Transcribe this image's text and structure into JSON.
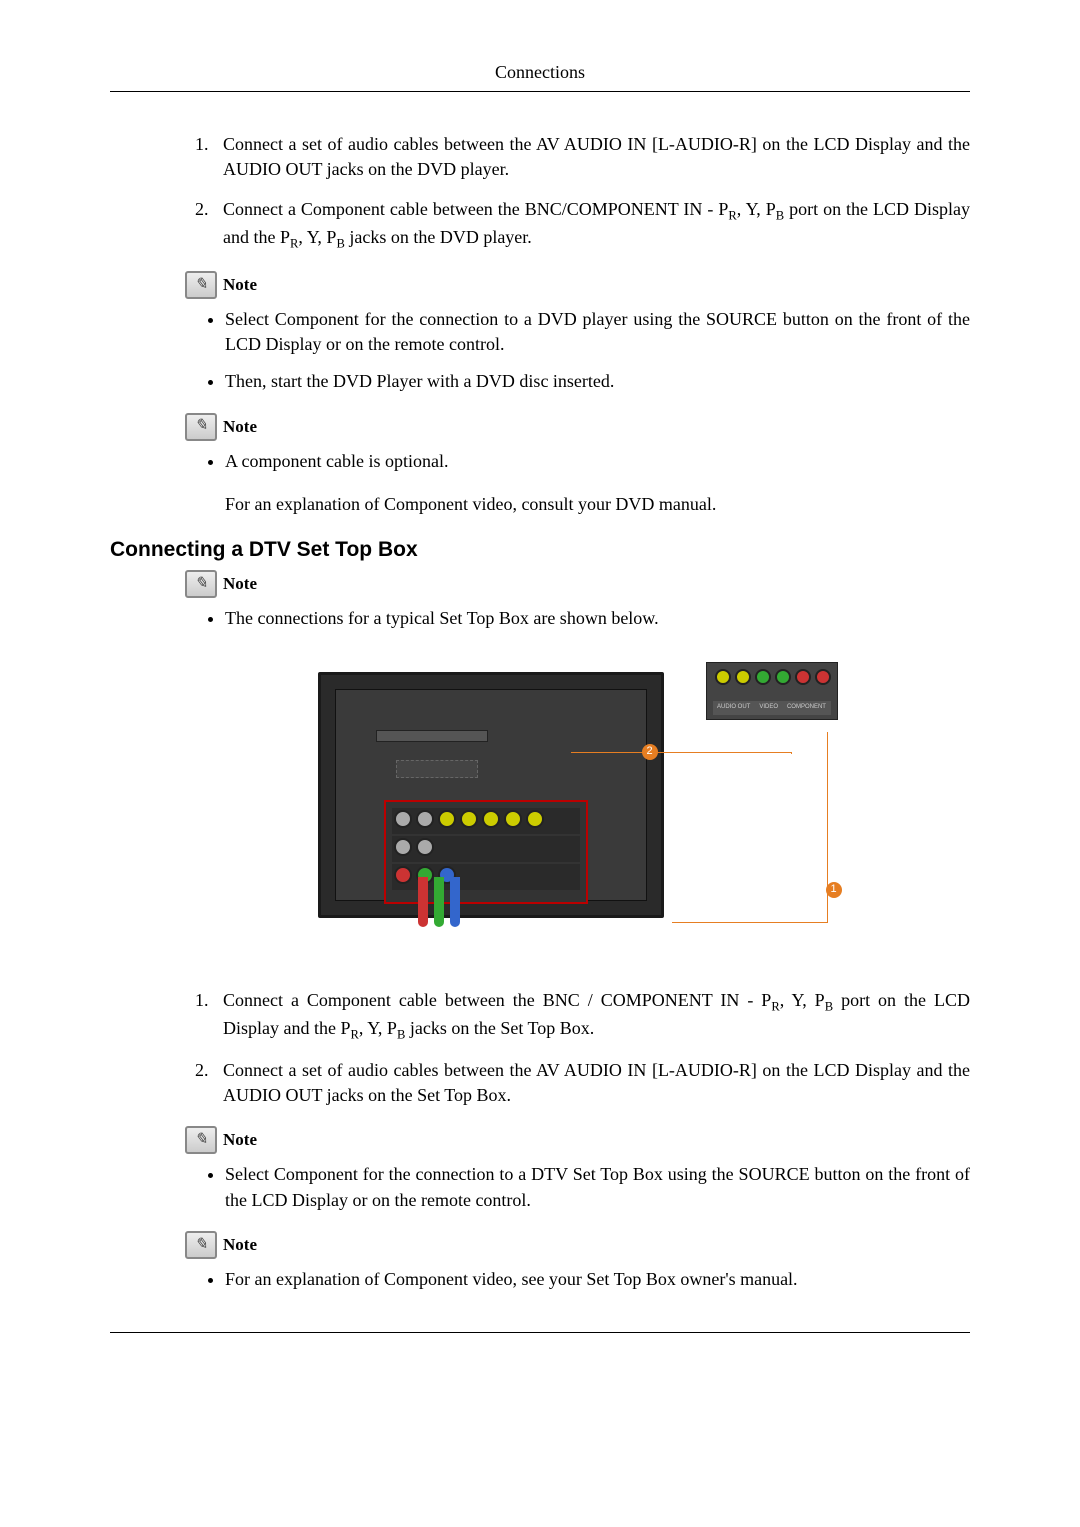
{
  "header": {
    "title": "Connections"
  },
  "steps_top": {
    "1": "Connect a set of audio cables between the AV AUDIO IN [L-AUDIO-R] on the LCD Display and the AUDIO OUT jacks on the DVD player.",
    "2_pre": "Connect a Component cable between the BNC/COMPONENT IN - P",
    "2_mid1": ", Y, P",
    "2_mid2": " port on the LCD Display and the P",
    "2_mid3": ", Y, P",
    "2_post": " jacks on the DVD player."
  },
  "note_label": "Note",
  "bullets_a": {
    "1": "Select Component for the connection to a DVD player using the SOURCE button on the front of the LCD Display or on the remote control.",
    "2": "Then, start the DVD Player with a DVD disc inserted."
  },
  "bullets_b": {
    "1": "A component cable is optional."
  },
  "para_b": "For an explanation of Component video, consult your DVD manual.",
  "section_title": "Connecting a DTV Set Top Box",
  "bullets_c": {
    "1": "The connections for a typical Set Top Box are shown below."
  },
  "diagram": {
    "stb_labels": {
      "a": "AUDIO OUT",
      "b": "VIDEO",
      "c": "COMPONENT"
    },
    "callout1": "1",
    "callout2": "2"
  },
  "steps_bottom": {
    "1_pre": "Connect a Component cable between the BNC / COMPONENT IN - P",
    "1_mid1": ", Y, P",
    "1_mid2": " port on the LCD Display and the P",
    "1_mid3": ", Y, P",
    "1_post": " jacks on the Set Top Box.",
    "2": "Connect a set of audio cables between the AV AUDIO IN [L-AUDIO-R] on the LCD Display and the AUDIO OUT jacks on the Set Top Box."
  },
  "bullets_d": {
    "1": "Select Component for the connection to a DTV Set Top Box using the SOURCE button on the front of the LCD Display or on the remote control."
  },
  "bullets_e": {
    "1": "For an explanation of Component video, see your Set Top Box owner's manual."
  },
  "sub": {
    "R": "R",
    "B": "B"
  }
}
